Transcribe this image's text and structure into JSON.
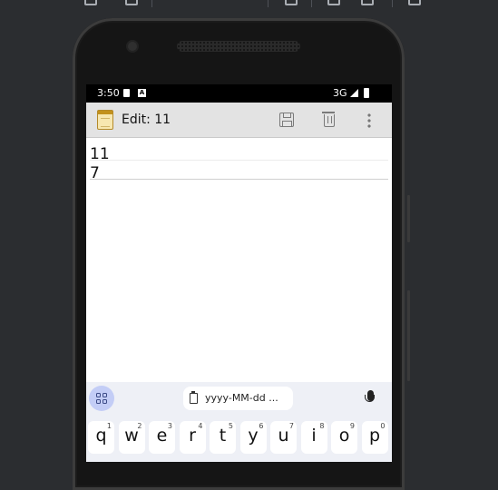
{
  "status_bar": {
    "time": "3:50",
    "network": "3G",
    "notif_icon": "A"
  },
  "app_bar": {
    "title": "Edit: 11",
    "icons": [
      "notepad-icon",
      "save-icon",
      "delete-icon",
      "overflow-menu-icon"
    ]
  },
  "editor": {
    "lines": [
      "11",
      "7"
    ]
  },
  "keyboard": {
    "suggestion": "yyyy-MM-dd ...",
    "keys": [
      {
        "char": "q",
        "num": "1"
      },
      {
        "char": "w",
        "num": "2"
      },
      {
        "char": "e",
        "num": "3"
      },
      {
        "char": "r",
        "num": "4"
      },
      {
        "char": "t",
        "num": "5"
      },
      {
        "char": "y",
        "num": "6"
      },
      {
        "char": "u",
        "num": "7"
      },
      {
        "char": "i",
        "num": "8"
      },
      {
        "char": "o",
        "num": "9"
      },
      {
        "char": "p",
        "num": "0"
      }
    ]
  }
}
